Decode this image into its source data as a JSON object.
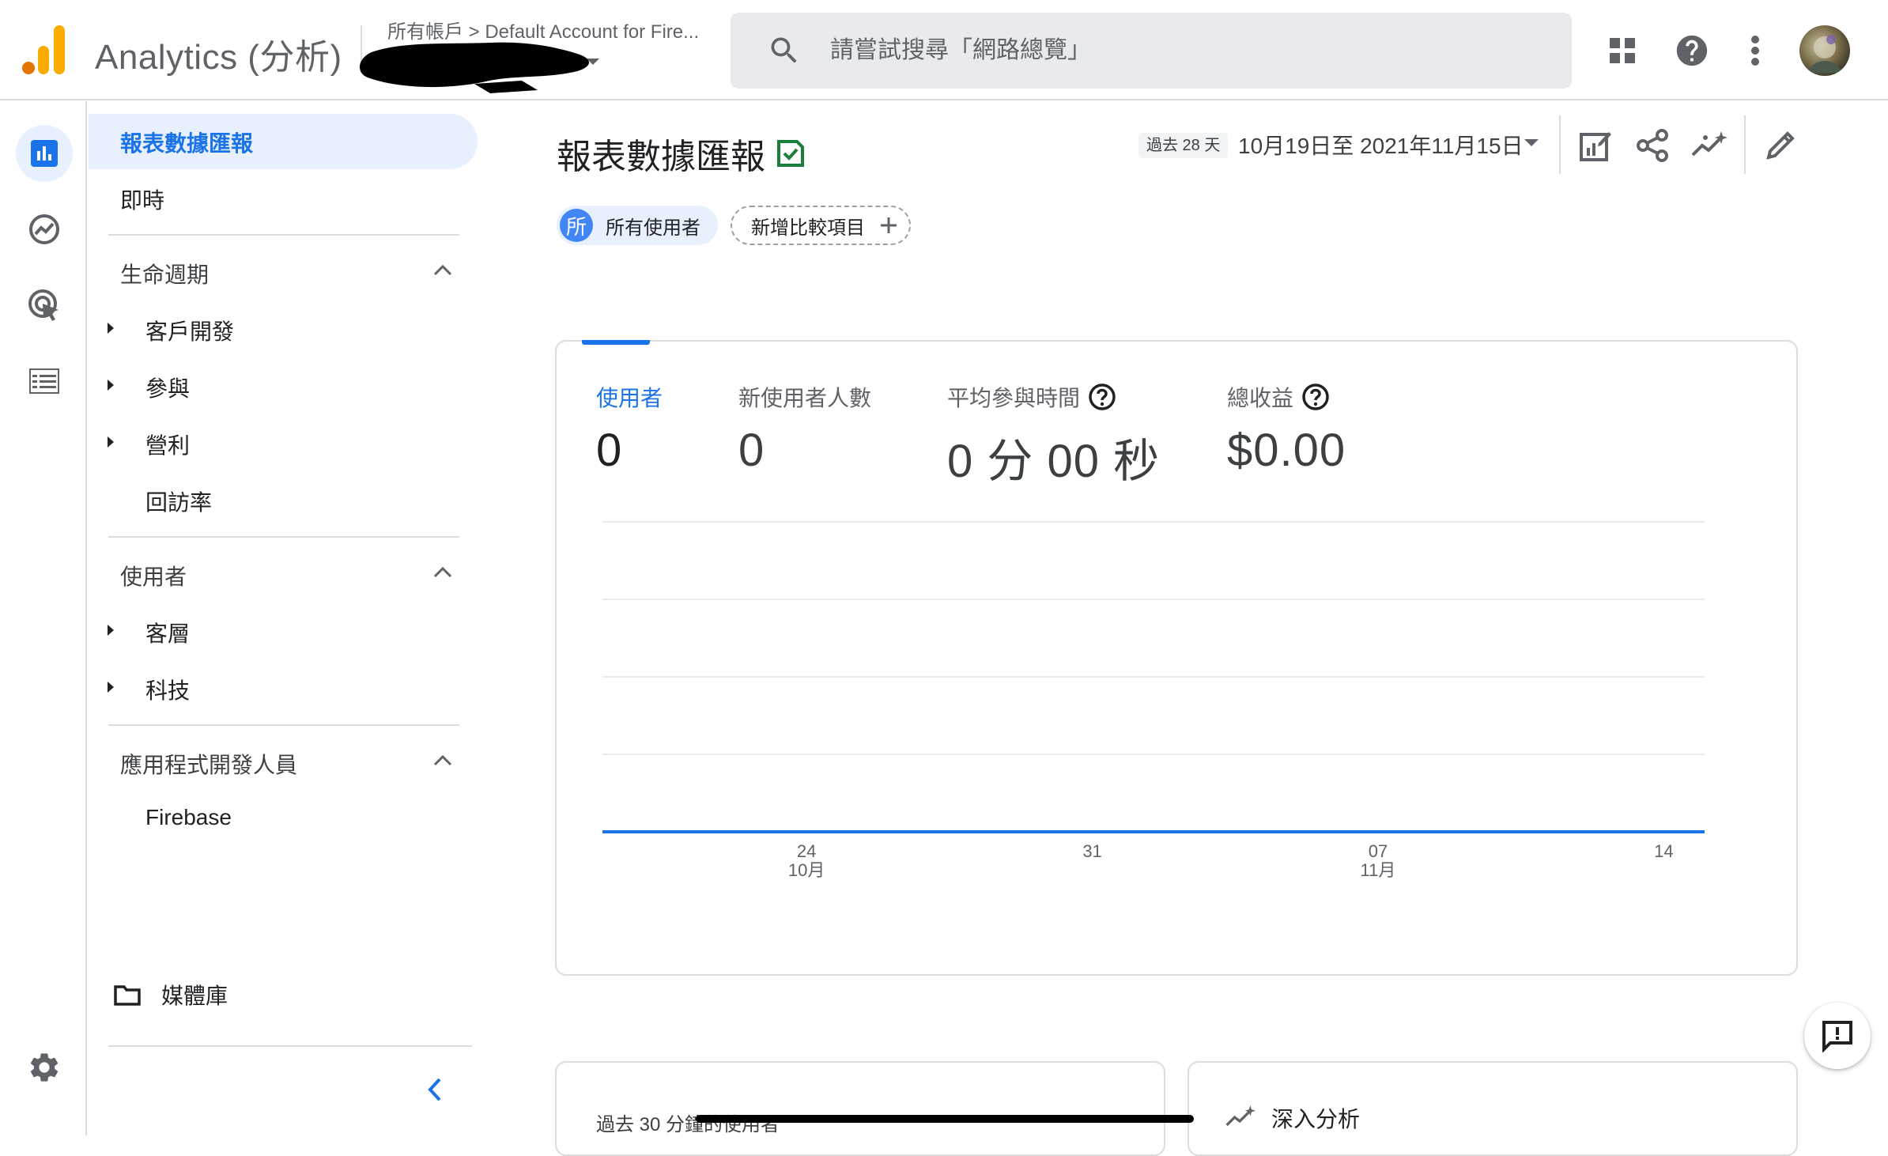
{
  "app": {
    "title": "Analytics (分析)",
    "breadcrumb": "所有帳戶 > Default Account for Fire..."
  },
  "search": {
    "placeholder": "請嘗試搜尋「網路總覽」"
  },
  "nav": {
    "items": [
      {
        "label": "報表數據匯報",
        "active": true
      },
      {
        "label": "即時"
      }
    ],
    "sections": [
      {
        "title": "生命週期",
        "items": [
          {
            "label": "客戶開發",
            "expandable": true
          },
          {
            "label": "參與",
            "expandable": true
          },
          {
            "label": "營利",
            "expandable": true
          },
          {
            "label": "回訪率",
            "expandable": false
          }
        ]
      },
      {
        "title": "使用者",
        "items": [
          {
            "label": "客層",
            "expandable": true
          },
          {
            "label": "科技",
            "expandable": true
          }
        ]
      },
      {
        "title": "應用程式開發人員",
        "items": [
          {
            "label": "Firebase",
            "expandable": false
          }
        ]
      }
    ],
    "library": "媒體庫"
  },
  "page": {
    "title": "報表數據匯報",
    "date_chip": "過去 28 天",
    "date_range": "10月19日至 2021年11月15日",
    "comparison": {
      "all_users_avatar": "所",
      "all_users": "所有使用者",
      "add_comparison": "新增比較項目"
    }
  },
  "metrics": [
    {
      "label": "使用者",
      "value": "0",
      "active": true
    },
    {
      "label": "新使用者人數",
      "value": "0"
    },
    {
      "label": "平均參與時間",
      "value": "0 分 00 秒",
      "help": true
    },
    {
      "label": "總收益",
      "value": "$0.00",
      "help": true
    }
  ],
  "chart_data": {
    "type": "line",
    "x_ticks": [
      {
        "day": "24",
        "month": "10月"
      },
      {
        "day": "31",
        "month": ""
      },
      {
        "day": "07",
        "month": "11月"
      },
      {
        "day": "14",
        "month": ""
      }
    ],
    "series": [
      {
        "values": [
          0,
          0,
          0,
          0,
          0,
          0,
          0,
          0,
          0,
          0,
          0,
          0,
          0,
          0,
          0,
          0,
          0,
          0,
          0,
          0,
          0,
          0,
          0,
          0,
          0,
          0,
          0,
          0
        ]
      }
    ],
    "grid": true,
    "color": "#1a73e8"
  },
  "bottom": {
    "recent_label": "過去 30 分鐘的使用者",
    "insights_label": "深入分析"
  },
  "colors": {
    "accent": "#1a73e8",
    "logo_orange": "#f9ab00",
    "logo_dark_orange": "#e37400"
  }
}
